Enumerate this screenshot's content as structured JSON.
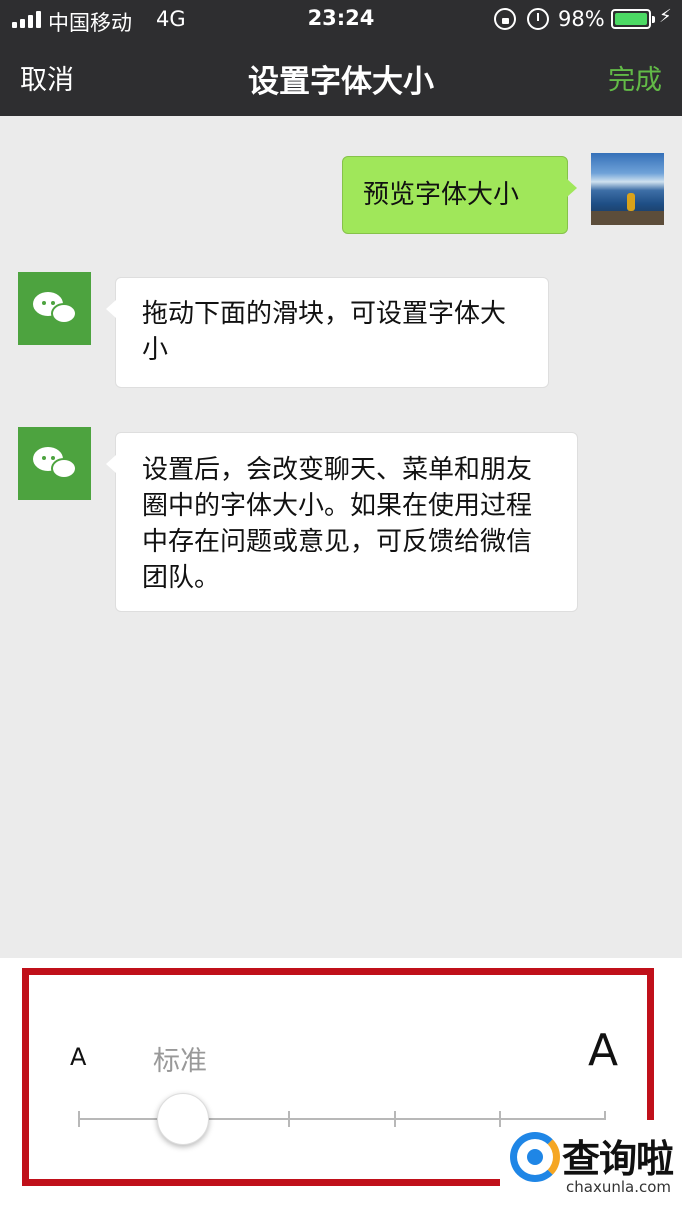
{
  "status_bar": {
    "carrier": "中国移动",
    "network": "4G",
    "time": "23:24",
    "battery_percent": "98%",
    "battery_level": 0.98,
    "icons": [
      "signal-icon",
      "orientation-lock-icon",
      "alarm-icon",
      "battery-icon",
      "charging-bolt-icon"
    ]
  },
  "nav": {
    "cancel_label": "取消",
    "title": "设置字体大小",
    "done_label": "完成",
    "done_color": "#62bb47"
  },
  "chat": {
    "messages": [
      {
        "side": "right",
        "text": "预览字体大小"
      },
      {
        "side": "left",
        "text": "拖动下面的滑块，可设置字体大小"
      },
      {
        "side": "left",
        "text": "设置后，会改变聊天、菜单和朋友圈中的字体大小。如果在使用过程中存在问题或意见，可反馈给微信团队。"
      }
    ],
    "bubble_right_color": "#a0e75a",
    "bubble_left_color": "#ffffff"
  },
  "slider": {
    "small_label": "A",
    "large_label": "A",
    "current_label": "标准",
    "steps": 6,
    "selected_step": 1
  },
  "watermark": {
    "brand": "查询啦",
    "domain": "chaxunla.com"
  }
}
